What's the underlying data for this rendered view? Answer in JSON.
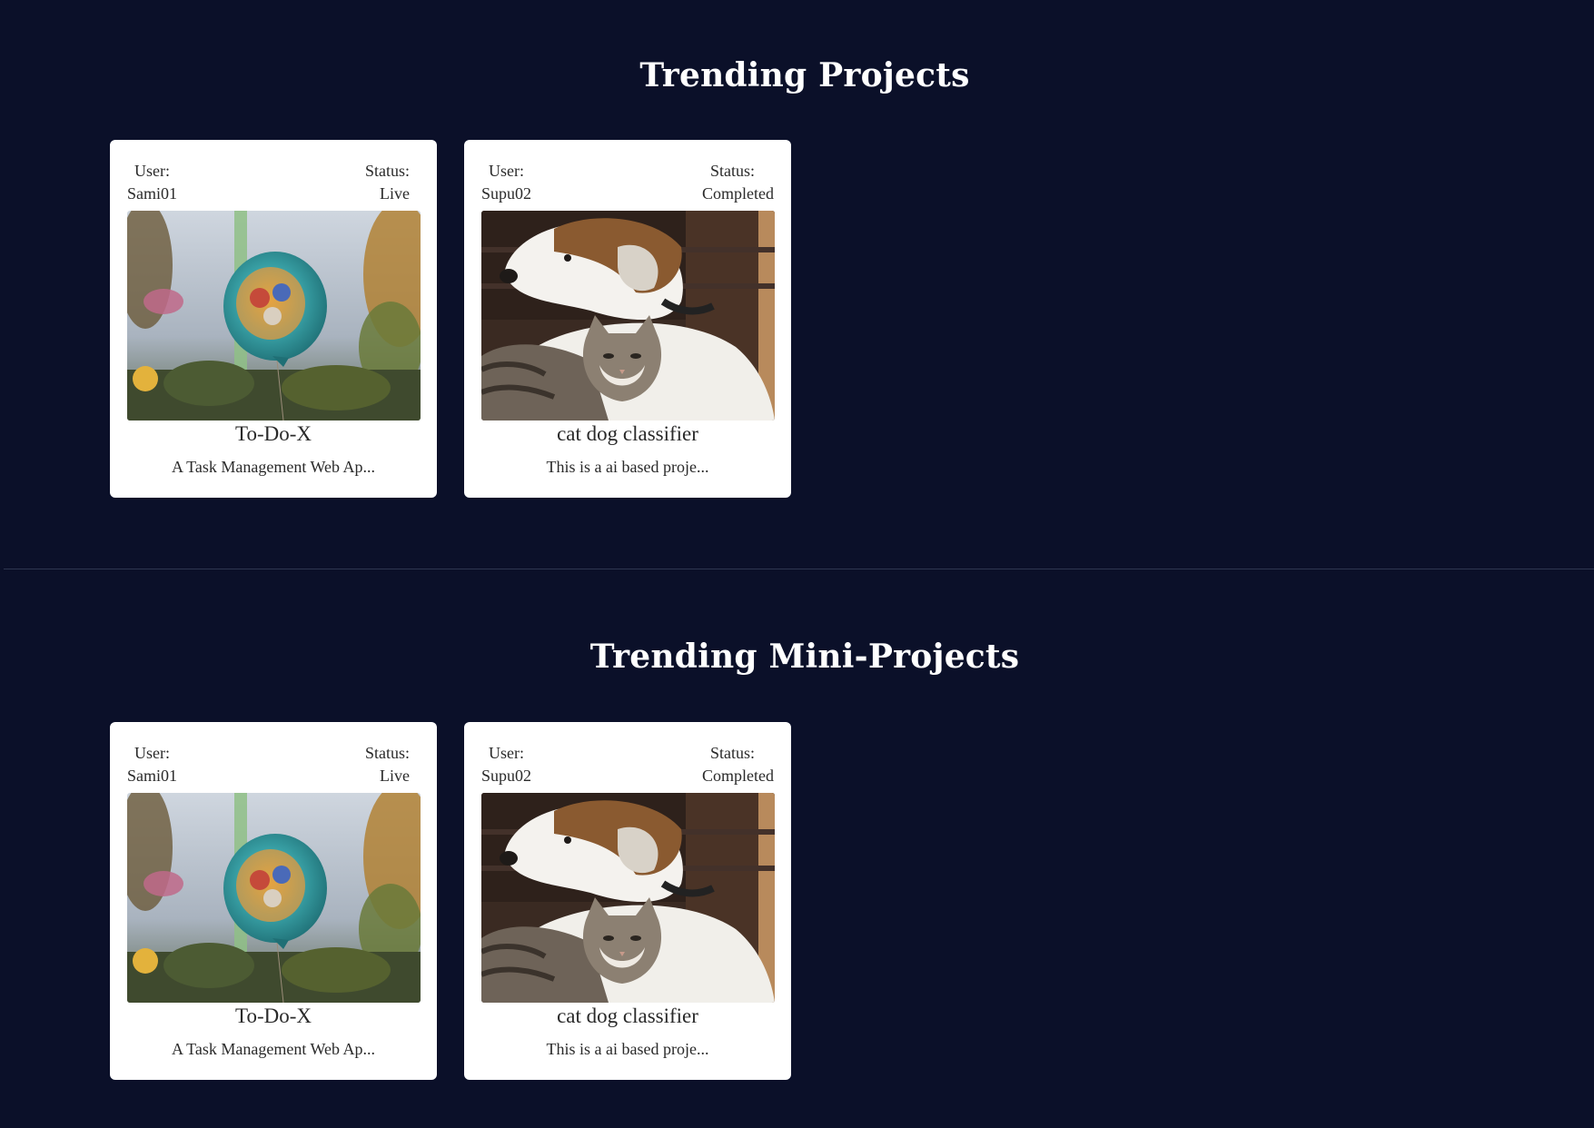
{
  "sections": [
    {
      "title": "Trending Projects",
      "cards": [
        {
          "user_label": "User:",
          "user": "Sami01",
          "status_label": "Status:",
          "status": "Live",
          "image": "balloon-photo",
          "name": "To-Do-X",
          "description": "A Task Management Web Ap..."
        },
        {
          "user_label": "User:",
          "user": "Supu02",
          "status_label": "Status:",
          "status": "Completed",
          "image": "dog-and-cat-photo",
          "name": "cat dog classifier",
          "description": "This is a ai based proje..."
        }
      ]
    },
    {
      "title": "Trending Mini-Projects",
      "cards": [
        {
          "user_label": "User:",
          "user": "Sami01",
          "status_label": "Status:",
          "status": "Live",
          "image": "balloon-photo",
          "name": "To-Do-X",
          "description": "A Task Management Web Ap..."
        },
        {
          "user_label": "User:",
          "user": "Supu02",
          "status_label": "Status:",
          "status": "Completed",
          "image": "dog-and-cat-photo",
          "name": "cat dog classifier",
          "description": "This is a ai based proje..."
        }
      ]
    }
  ],
  "colors": {
    "background": "#0b1029",
    "card": "#ffffff",
    "title_text": "#ffffff",
    "card_text": "#2a2a2a"
  }
}
